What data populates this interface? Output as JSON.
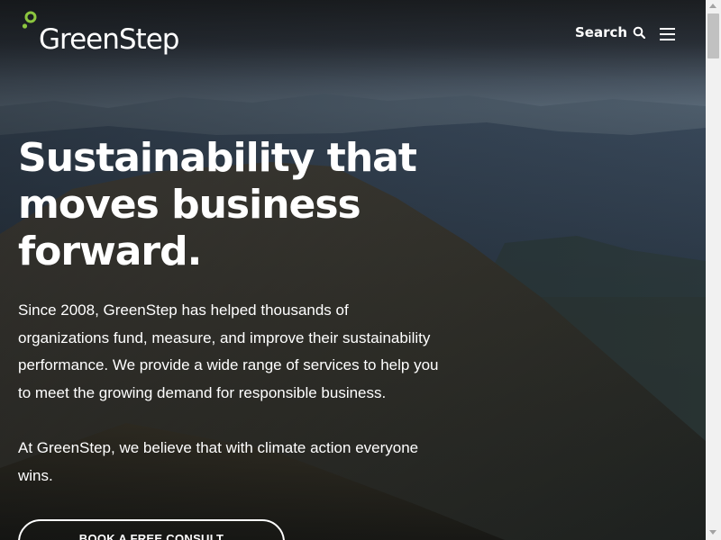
{
  "header": {
    "logo_text": "GreenStep",
    "search_label": "Search",
    "search_icon": "magnifier",
    "menu_icon": "hamburger"
  },
  "hero": {
    "title": "Sustainability that moves business forward.",
    "paragraph_1": "Since 2008, GreenStep has helped thousands of organizations fund, measure, and improve their sustainability performance. We provide a wide range of services to help you to meet the growing demand for responsible business.",
    "paragraph_2": "At GreenStep, we believe that with climate action everyone wins.",
    "cta_label": "BOOK A FREE CONSULT"
  },
  "colors": {
    "brand_green": "#8cc63f",
    "text": "#ffffff"
  }
}
